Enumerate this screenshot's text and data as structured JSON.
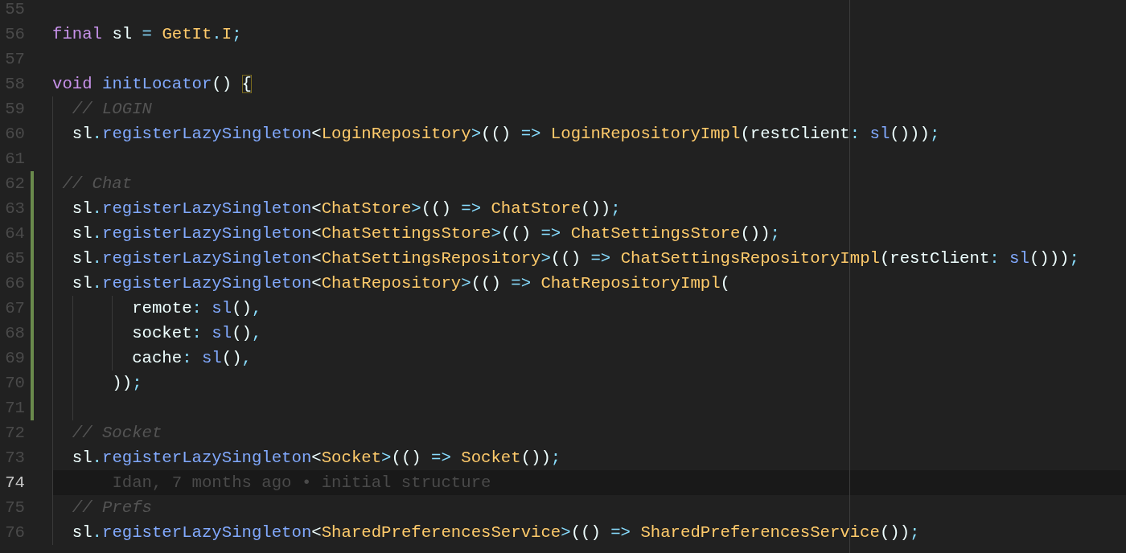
{
  "lines": [
    {
      "number": "55",
      "current": false,
      "git_changed": false
    },
    {
      "number": "56",
      "current": false,
      "git_changed": false,
      "tokens": [
        {
          "kind": "keyword",
          "text": "final"
        },
        {
          "kind": "plain",
          "text": " sl "
        },
        {
          "kind": "punct",
          "text": "="
        },
        {
          "kind": "type",
          "text": " GetIt"
        },
        {
          "kind": "punct",
          "text": "."
        },
        {
          "kind": "type",
          "text": "I"
        },
        {
          "kind": "punct",
          "text": ";"
        }
      ]
    },
    {
      "number": "57",
      "current": false,
      "git_changed": false
    },
    {
      "number": "58",
      "current": false,
      "git_changed": false,
      "tokens": [
        {
          "kind": "keyword",
          "text": "void"
        },
        {
          "kind": "function",
          "text": " initLocator"
        },
        {
          "kind": "plain",
          "text": "() "
        },
        {
          "kind": "brace-match",
          "text": "{"
        }
      ]
    },
    {
      "number": "59",
      "current": false,
      "git_changed": false,
      "tokens": [
        {
          "kind": "comment",
          "text": "  // LOGIN"
        }
      ]
    },
    {
      "number": "60",
      "current": false,
      "git_changed": false,
      "tokens": [
        {
          "kind": "plain",
          "text": "  sl"
        },
        {
          "kind": "punct",
          "text": "."
        },
        {
          "kind": "function",
          "text": "registerLazySingleton"
        },
        {
          "kind": "plain",
          "text": "<"
        },
        {
          "kind": "type",
          "text": "LoginRepository"
        },
        {
          "kind": "punct",
          "text": ">"
        },
        {
          "kind": "plain",
          "text": "(() "
        },
        {
          "kind": "punct",
          "text": "=>"
        },
        {
          "kind": "type",
          "text": " LoginRepositoryImpl"
        },
        {
          "kind": "plain",
          "text": "(restClient"
        },
        {
          "kind": "punct",
          "text": ":"
        },
        {
          "kind": "function",
          "text": " sl"
        },
        {
          "kind": "plain",
          "text": "()))"
        },
        {
          "kind": "punct",
          "text": ";"
        }
      ]
    },
    {
      "number": "61",
      "current": false,
      "git_changed": false
    },
    {
      "number": "62",
      "current": false,
      "git_changed": true,
      "tokens": [
        {
          "kind": "comment",
          "text": " // Chat"
        }
      ]
    },
    {
      "number": "63",
      "current": false,
      "git_changed": true,
      "tokens": [
        {
          "kind": "plain",
          "text": "  sl"
        },
        {
          "kind": "punct",
          "text": "."
        },
        {
          "kind": "function",
          "text": "registerLazySingleton"
        },
        {
          "kind": "plain",
          "text": "<"
        },
        {
          "kind": "type",
          "text": "ChatStore"
        },
        {
          "kind": "punct",
          "text": ">"
        },
        {
          "kind": "plain",
          "text": "(() "
        },
        {
          "kind": "punct",
          "text": "=>"
        },
        {
          "kind": "type",
          "text": " ChatStore"
        },
        {
          "kind": "plain",
          "text": "())"
        },
        {
          "kind": "punct",
          "text": ";"
        }
      ]
    },
    {
      "number": "64",
      "current": false,
      "git_changed": true,
      "tokens": [
        {
          "kind": "plain",
          "text": "  sl"
        },
        {
          "kind": "punct",
          "text": "."
        },
        {
          "kind": "function",
          "text": "registerLazySingleton"
        },
        {
          "kind": "plain",
          "text": "<"
        },
        {
          "kind": "type",
          "text": "ChatSettingsStore"
        },
        {
          "kind": "punct",
          "text": ">"
        },
        {
          "kind": "plain",
          "text": "(() "
        },
        {
          "kind": "punct",
          "text": "=>"
        },
        {
          "kind": "type",
          "text": " ChatSettingsStore"
        },
        {
          "kind": "plain",
          "text": "())"
        },
        {
          "kind": "punct",
          "text": ";"
        }
      ]
    },
    {
      "number": "65",
      "current": false,
      "git_changed": true,
      "tokens": [
        {
          "kind": "plain",
          "text": "  sl"
        },
        {
          "kind": "punct",
          "text": "."
        },
        {
          "kind": "function",
          "text": "registerLazySingleton"
        },
        {
          "kind": "plain",
          "text": "<"
        },
        {
          "kind": "type",
          "text": "ChatSettingsRepository"
        },
        {
          "kind": "punct",
          "text": ">"
        },
        {
          "kind": "plain",
          "text": "(() "
        },
        {
          "kind": "punct",
          "text": "=>"
        },
        {
          "kind": "type",
          "text": " ChatSettingsRepositoryImpl"
        },
        {
          "kind": "plain",
          "text": "(restClient"
        },
        {
          "kind": "punct",
          "text": ":"
        },
        {
          "kind": "function",
          "text": " sl"
        },
        {
          "kind": "plain",
          "text": "()))"
        },
        {
          "kind": "punct",
          "text": ";"
        }
      ]
    },
    {
      "number": "66",
      "current": false,
      "git_changed": true,
      "tokens": [
        {
          "kind": "plain",
          "text": "  sl"
        },
        {
          "kind": "punct",
          "text": "."
        },
        {
          "kind": "function",
          "text": "registerLazySingleton"
        },
        {
          "kind": "plain",
          "text": "<"
        },
        {
          "kind": "type",
          "text": "ChatRepository"
        },
        {
          "kind": "punct",
          "text": ">"
        },
        {
          "kind": "plain",
          "text": "(() "
        },
        {
          "kind": "punct",
          "text": "=>"
        },
        {
          "kind": "type",
          "text": " ChatRepositoryImpl"
        },
        {
          "kind": "plain",
          "text": "("
        }
      ]
    },
    {
      "number": "67",
      "current": false,
      "git_changed": true,
      "tokens": [
        {
          "kind": "plain",
          "text": "        remote"
        },
        {
          "kind": "punct",
          "text": ":"
        },
        {
          "kind": "function",
          "text": " sl"
        },
        {
          "kind": "plain",
          "text": "()"
        },
        {
          "kind": "punct",
          "text": ","
        }
      ]
    },
    {
      "number": "68",
      "current": false,
      "git_changed": true,
      "tokens": [
        {
          "kind": "plain",
          "text": "        socket"
        },
        {
          "kind": "punct",
          "text": ":"
        },
        {
          "kind": "function",
          "text": " sl"
        },
        {
          "kind": "plain",
          "text": "()"
        },
        {
          "kind": "punct",
          "text": ","
        }
      ]
    },
    {
      "number": "69",
      "current": false,
      "git_changed": true,
      "tokens": [
        {
          "kind": "plain",
          "text": "        cache"
        },
        {
          "kind": "punct",
          "text": ":"
        },
        {
          "kind": "function",
          "text": " sl"
        },
        {
          "kind": "plain",
          "text": "()"
        },
        {
          "kind": "punct",
          "text": ","
        }
      ]
    },
    {
      "number": "70",
      "current": false,
      "git_changed": true,
      "tokens": [
        {
          "kind": "plain",
          "text": "      ))"
        },
        {
          "kind": "punct",
          "text": ";"
        }
      ]
    },
    {
      "number": "71",
      "current": false,
      "git_changed": true
    },
    {
      "number": "72",
      "current": false,
      "git_changed": false,
      "tokens": [
        {
          "kind": "comment",
          "text": "  // Socket"
        }
      ]
    },
    {
      "number": "73",
      "current": false,
      "git_changed": false,
      "tokens": [
        {
          "kind": "plain",
          "text": "  sl"
        },
        {
          "kind": "punct",
          "text": "."
        },
        {
          "kind": "function",
          "text": "registerLazySingleton"
        },
        {
          "kind": "plain",
          "text": "<"
        },
        {
          "kind": "type",
          "text": "Socket"
        },
        {
          "kind": "punct",
          "text": ">"
        },
        {
          "kind": "plain",
          "text": "(() "
        },
        {
          "kind": "punct",
          "text": "=>"
        },
        {
          "kind": "type",
          "text": " Socket"
        },
        {
          "kind": "plain",
          "text": "())"
        },
        {
          "kind": "punct",
          "text": ";"
        }
      ]
    },
    {
      "number": "74",
      "current": true,
      "git_changed": false,
      "blame": "Idan, 7 months ago • initial structure"
    },
    {
      "number": "75",
      "current": false,
      "git_changed": false,
      "tokens": [
        {
          "kind": "comment",
          "text": "  // Prefs"
        }
      ]
    },
    {
      "number": "76",
      "current": false,
      "git_changed": false,
      "tokens": [
        {
          "kind": "plain",
          "text": "  sl"
        },
        {
          "kind": "punct",
          "text": "."
        },
        {
          "kind": "function",
          "text": "registerLazySingleton"
        },
        {
          "kind": "plain",
          "text": "<"
        },
        {
          "kind": "type",
          "text": "SharedPreferencesService"
        },
        {
          "kind": "punct",
          "text": ">"
        },
        {
          "kind": "plain",
          "text": "(() "
        },
        {
          "kind": "punct",
          "text": "=>"
        },
        {
          "kind": "type",
          "text": " SharedPreferencesService"
        },
        {
          "kind": "plain",
          "text": "())"
        },
        {
          "kind": "punct",
          "text": ";"
        }
      ]
    }
  ]
}
